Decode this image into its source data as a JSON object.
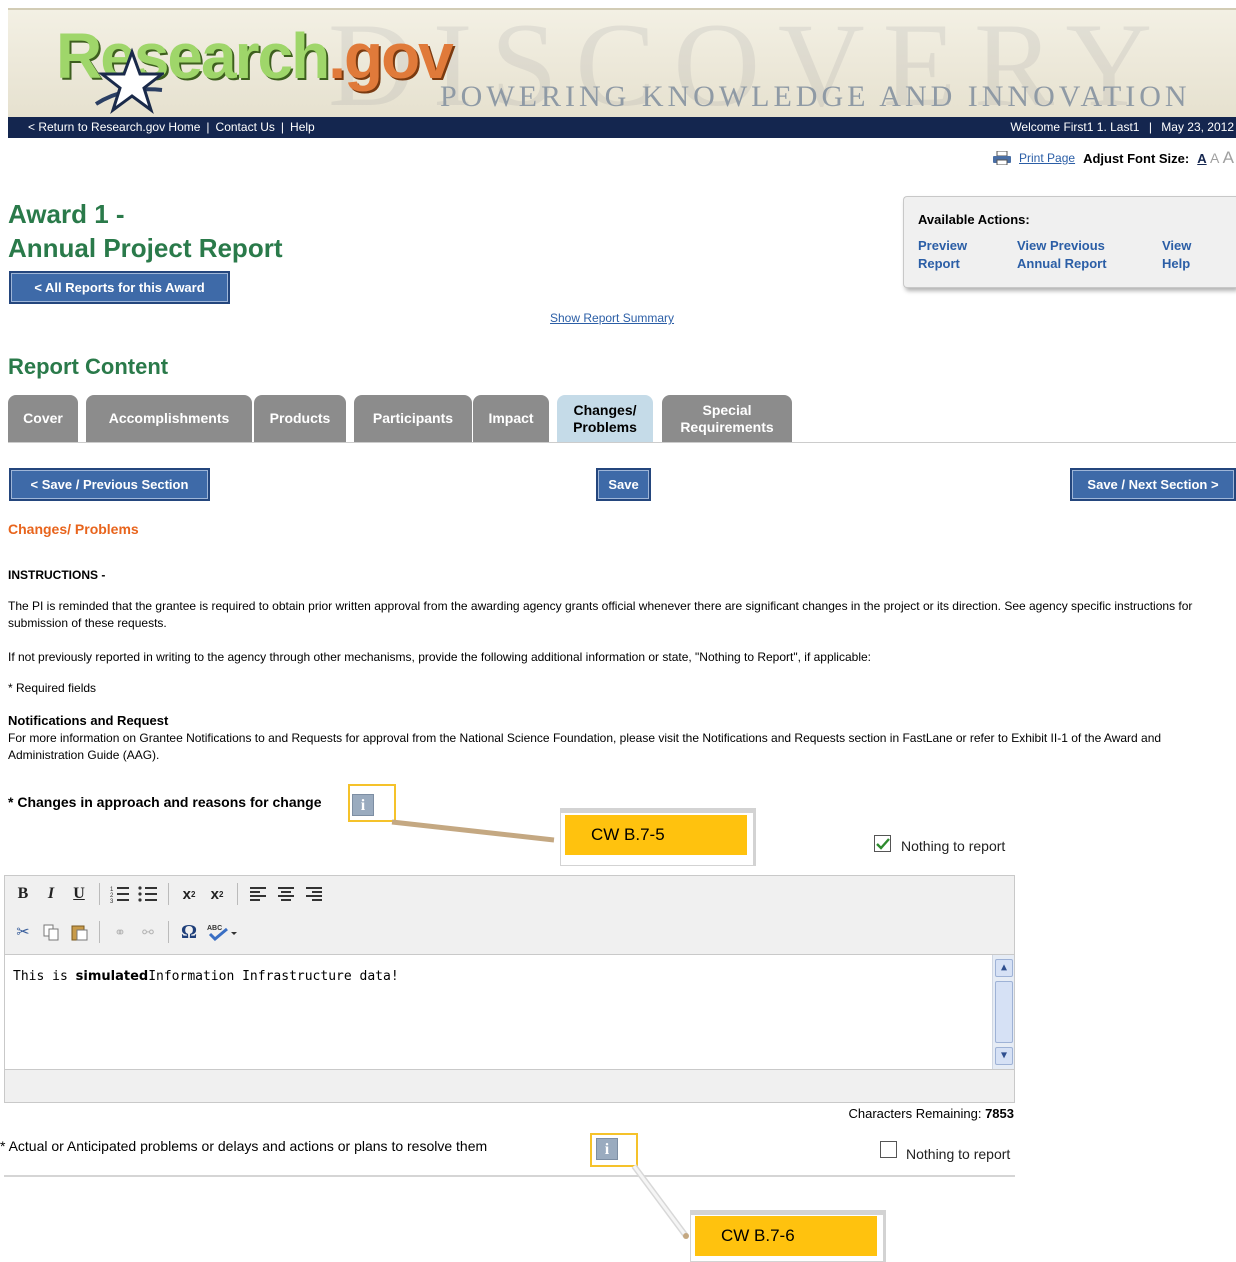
{
  "header": {
    "logo_main": "Research",
    "logo_suffix": ".gov",
    "tagline": "POWERING KNOWLEDGE AND INNOVATION",
    "watermark": "DISCOVERY",
    "nav": [
      "< Return to Research.gov Home",
      "Contact Us",
      "Help"
    ],
    "welcome": "Welcome First1 1. Last1",
    "date": "May 23, 2012"
  },
  "utility": {
    "print_label": "Print Page",
    "font_size_label": "Adjust Font Size:",
    "font_a": "A"
  },
  "page": {
    "title_line1": "Award 1 -",
    "title_line2": "Annual Project Report",
    "all_reports_button": "< All Reports for this Award",
    "show_summary": "Show Report Summary",
    "section_title": "Report Content"
  },
  "actions": {
    "title": "Available Actions:",
    "items": [
      {
        "line1": "Preview",
        "line2": "Report"
      },
      {
        "line1": "View Previous",
        "line2": "Annual Report"
      },
      {
        "line1": "View",
        "line2": "Help"
      }
    ]
  },
  "tabs": [
    {
      "line1": "Cover",
      "line2": ""
    },
    {
      "line1": "Accomplishments",
      "line2": ""
    },
    {
      "line1": "Products",
      "line2": ""
    },
    {
      "line1": "Participants",
      "line2": ""
    },
    {
      "line1": "Impact",
      "line2": ""
    },
    {
      "line1": "Changes/",
      "line2": "Problems"
    },
    {
      "line1": "Special",
      "line2": "Requirements"
    }
  ],
  "active_tab": "Changes/ Problems",
  "nav_buttons": {
    "previous": "< Save / Previous Section",
    "save": "Save",
    "next": "Save / Next Section >"
  },
  "content": {
    "heading": "Changes/ Problems",
    "instructions_title": "INSTRUCTIONS -",
    "instructions_p1": "The PI is reminded that the grantee is required to obtain prior written approval from the awarding agency grants official whenever there are significant changes in the project or its direction. See agency specific instructions for submission of these requests.",
    "instructions_p2": "If not previously reported in writing to the agency through other mechanisms, provide the following additional information or state, \"Nothing to Report\", if applicable:",
    "required_note": "* Required fields",
    "notif_title": "Notifications and Request",
    "notif_text": "For more information on Grantee Notifications to and Requests for approval from the National Science Foundation, please visit the Notifications and Requests section in FastLane or refer to Exhibit II-1 of the Award and Administration Guide (AAG)."
  },
  "field1": {
    "label": "* Changes in approach and reasons for change",
    "nothing_label": "Nothing to report",
    "nothing_checked": true,
    "callout": "CW B.7-5",
    "editor_text_plain1": "This is ",
    "editor_text_bold": "simulated",
    "editor_text_plain2": "Information Infrastructure data!",
    "chars_label": "Characters Remaining:",
    "chars_value": "7853"
  },
  "field2": {
    "label": "* Actual or Anticipated problems or delays and actions or plans to resolve them",
    "nothing_label": "Nothing to report",
    "nothing_checked": false,
    "callout": "CW B.7-6"
  },
  "colors": {
    "brand_green": "#2a7a4a",
    "brand_blue": "#3e6aa8",
    "accent_orange": "#e8641c",
    "callout_yellow": "#ffc20e",
    "header_navy": "#14264f"
  }
}
